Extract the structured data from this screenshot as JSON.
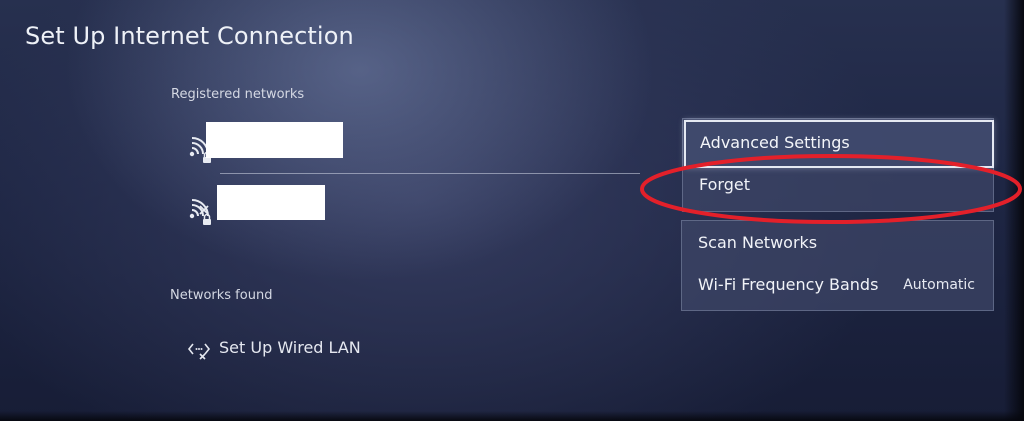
{
  "page": {
    "title": "Set Up Internet Connection"
  },
  "registered": {
    "heading": "Registered networks",
    "networks": [
      {
        "icon": "wifi-locked-icon"
      },
      {
        "icon": "wifi-locked-disabled-icon"
      }
    ]
  },
  "found": {
    "heading": "Networks found",
    "wired": {
      "label": "Set Up Wired LAN",
      "icon": "wired-lan-disconnected-icon"
    }
  },
  "context_menu": {
    "advanced_settings": "Advanced Settings",
    "forget": "Forget"
  },
  "options_menu": {
    "scan_networks": "Scan Networks",
    "wifi_bands_label": "Wi-Fi Frequency Bands",
    "wifi_bands_value": "Automatic"
  },
  "annotation": {
    "color": "#e3202a"
  },
  "colors": {
    "background": "#1e2644",
    "menu_panel": "#3e4668"
  }
}
